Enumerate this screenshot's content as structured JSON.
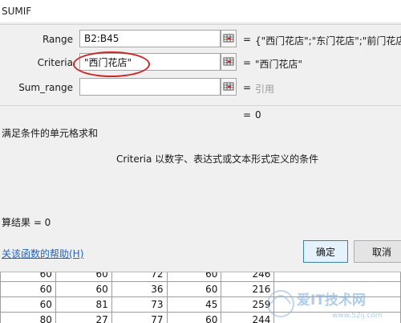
{
  "dialog": {
    "title": "SUMIF",
    "args": [
      {
        "label": "Range",
        "value": "B2:B45",
        "result": "{\"西门花店\";\"东门花店\";\"前门花店\"",
        "result_dim": false
      },
      {
        "label": "Criteria",
        "value": "\"西门花店\"",
        "result": "\"西门花店\"",
        "result_dim": false
      },
      {
        "label": "Sum_range",
        "value": "",
        "result": "引用",
        "result_dim": true
      }
    ],
    "equals": "=",
    "total_value": "0",
    "description": "满足条件的单元格求和",
    "criteria_help": "Criteria   以数字、表达式或文本形式定义的条件",
    "calc_result": "算结果 =   0",
    "help_link": "关该函数的帮助(H)",
    "ok_label": "确定",
    "cancel_label": "取消"
  },
  "sheet": {
    "rows": [
      [
        "60",
        "60",
        "72",
        "60",
        "246"
      ],
      [
        "60",
        "60",
        "36",
        "60",
        "216"
      ],
      [
        "60",
        "81",
        "73",
        "45",
        "259"
      ],
      [
        "80",
        "27",
        "77",
        "60",
        "244"
      ]
    ]
  },
  "watermark": {
    "text": "爱IT技术网",
    "url": "www.52ij.com"
  },
  "colors": {
    "highlight": "#c82828",
    "link": "#2563b8",
    "dialog_bg": "#f0f0f0"
  }
}
